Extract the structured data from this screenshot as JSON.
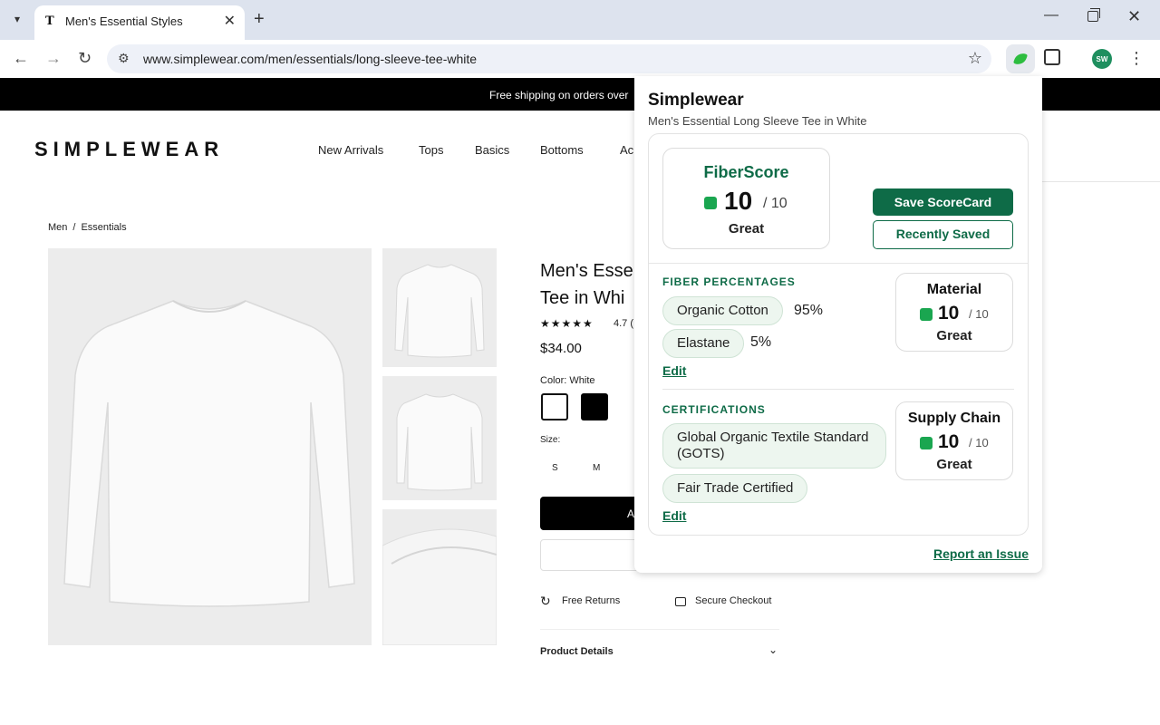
{
  "browser": {
    "tab_title": "Men's Essential Styles",
    "tab_favicon": "T",
    "url": "www.simplewear.com/men/essentials/long-sleeve-tee-white",
    "profile_initials": "SW"
  },
  "icons": {
    "tab_list": "chevron-down-icon",
    "back": "arrow-left-icon",
    "forward": "arrow-right-icon",
    "reload": "reload-icon",
    "site_info": "tune-icon",
    "bookmark": "star-icon",
    "extension": "leaf-icon",
    "extensions_menu": "puzzle-icon",
    "returns": "refresh-icon",
    "checkout": "lock-icon",
    "details": "chevron-down-icon"
  },
  "page": {
    "announcement": "Free shipping on orders over",
    "logo": "SIMPLEWEAR",
    "nav": [
      "New Arrivals",
      "Tops",
      "Basics",
      "Bottoms",
      "Ac"
    ],
    "breadcrumb": [
      "Men",
      "Essentials"
    ],
    "product_title": "Men's Esse\nTee in Whi",
    "stars": "★★★★★",
    "rating": "4.7 (",
    "price": "$34.00",
    "color_label": "Color: White",
    "size_label": "Size:",
    "sizes": [
      "S",
      "M"
    ],
    "add_button": "A",
    "free_returns": "Free Returns",
    "secure_checkout": "Secure Checkout",
    "product_details": "Product Details"
  },
  "popup": {
    "brand": "Simplewear",
    "product": "Men's Essential Long Sleeve Tee in White",
    "fiberscore": {
      "title": "FiberScore",
      "score": "10",
      "max": "/ 10",
      "rating": "Great"
    },
    "save_button": "Save ScoreCard",
    "recent_button": "Recently Saved",
    "fiber_section": {
      "heading": "FIBER PERCENTAGES",
      "items": [
        {
          "name": "Organic Cotton",
          "percent": "95%"
        },
        {
          "name": "Elastane",
          "percent": "5%"
        }
      ],
      "edit": "Edit"
    },
    "material": {
      "title": "Material",
      "score": "10",
      "max": "/ 10",
      "rating": "Great"
    },
    "cert_section": {
      "heading": "CERTIFICATIONS",
      "items": [
        "Global Organic Textile Standard (GOTS)",
        "Fair Trade Certified"
      ],
      "edit": "Edit"
    },
    "supply_chain": {
      "title": "Supply Chain",
      "score": "10",
      "max": "/ 10",
      "rating": "Great"
    },
    "report": "Report an Issue"
  },
  "colors": {
    "brand_green": "#0e6b47",
    "score_green": "#1aa650",
    "chip_bg": "#edf6ef"
  }
}
